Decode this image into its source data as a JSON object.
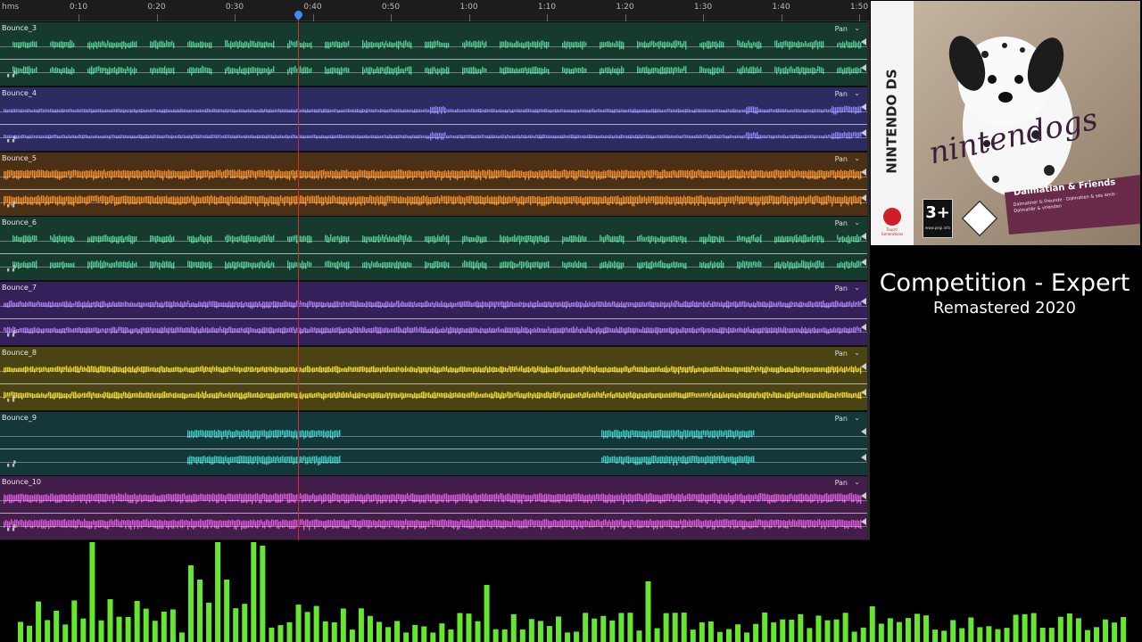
{
  "ruler": {
    "unit_label": "hms",
    "ticks": [
      "0:10",
      "0:20",
      "0:30",
      "0:40",
      "0:50",
      "1:00",
      "1:10",
      "1:20",
      "1:30",
      "1:40",
      "1:50"
    ]
  },
  "tracks": [
    {
      "name": "Bounce_3",
      "pan": "Pan",
      "color": "#4dc48f",
      "bg": "#173a2e",
      "pattern": "sparse"
    },
    {
      "name": "Bounce_4",
      "pan": "Pan",
      "color": "#8a7cf2",
      "bg": "#2c2c62",
      "pattern": "thin"
    },
    {
      "name": "Bounce_5",
      "pan": "Pan",
      "color": "#f08b2a",
      "bg": "#4a3014",
      "pattern": "dense"
    },
    {
      "name": "Bounce_6",
      "pan": "Pan",
      "color": "#4dc48f",
      "bg": "#173a2e",
      "pattern": "sparse"
    },
    {
      "name": "Bounce_7",
      "pan": "Pan",
      "color": "#a673e8",
      "bg": "#35215a",
      "pattern": "medium"
    },
    {
      "name": "Bounce_8",
      "pan": "Pan",
      "color": "#e8d22a",
      "bg": "#4a4414",
      "pattern": "medium"
    },
    {
      "name": "Bounce_9",
      "pan": "Pan",
      "color": "#3cc8c0",
      "bg": "#14383a",
      "pattern": "blocks"
    },
    {
      "name": "Bounce_10",
      "pan": "Pan",
      "color": "#d85ad8",
      "bg": "#441e4a",
      "pattern": "dense"
    }
  ],
  "cover": {
    "platform": "NINTENDO DS",
    "logo": "nintendogs",
    "edition": "Dalmatian & Friends",
    "edition_sub": "Dalmatiner & Freunde · Dalmatien & ses amis · Dalmatiër & vrienden",
    "rating": "3+",
    "rating_site": "www.pegi.info",
    "publisher_text": "Touch! Generations",
    "accent": "#6a2a4a"
  },
  "song": {
    "title": "Competition - Expert",
    "subtitle": "Remastered 2020"
  },
  "spectrum": {
    "color": "#66e630"
  }
}
